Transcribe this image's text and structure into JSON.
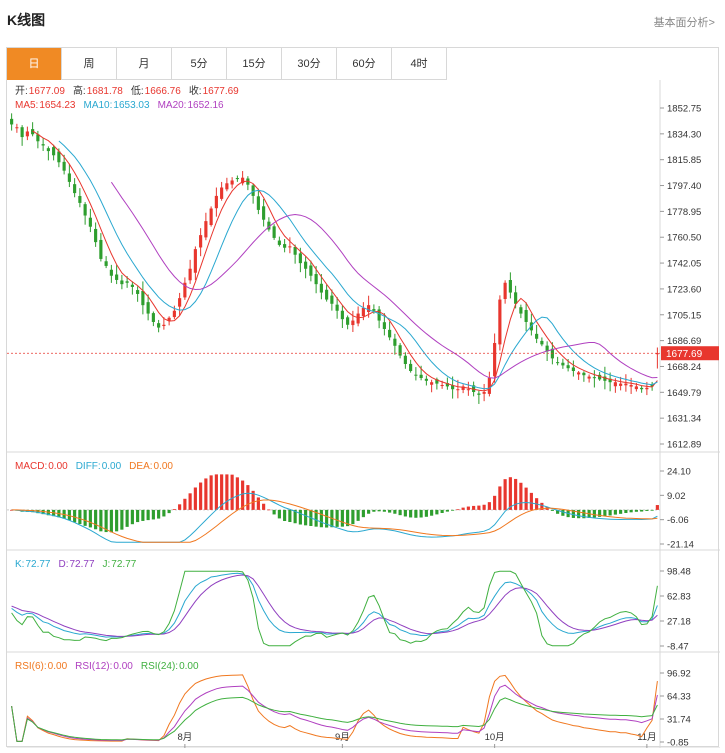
{
  "page": {
    "title": "K线图",
    "link": "基本面分析>"
  },
  "tabs": [
    {
      "label": "日",
      "active": true
    },
    {
      "label": "周",
      "active": false
    },
    {
      "label": "月",
      "active": false
    },
    {
      "label": "5分",
      "active": false
    },
    {
      "label": "15分",
      "active": false
    },
    {
      "label": "30分",
      "active": false
    },
    {
      "label": "60分",
      "active": false
    },
    {
      "label": "4时",
      "active": false
    }
  ],
  "colors": {
    "up": "#e8362e",
    "down": "#2e9e2e",
    "ma5": "#e8362e",
    "ma10": "#2aa8d0",
    "ma20": "#b040c0",
    "macd": "#e8362e",
    "diff": "#2aa8d0",
    "dea": "#f07820",
    "kdj_k": "#2aa8d0",
    "kdj_d": "#9040c0",
    "kdj_j": "#40b040",
    "rsi6": "#f07820",
    "rsi12": "#b040c0",
    "rsi24": "#40b040",
    "price_tag": "#e8362e"
  },
  "legend": {
    "ohlc": [
      {
        "label": "开:",
        "value": "1677.09"
      },
      {
        "label": "高:",
        "value": "1681.78"
      },
      {
        "label": "低:",
        "value": "1666.76"
      },
      {
        "label": "收:",
        "value": "1677.69"
      }
    ],
    "ma": [
      {
        "label": "MA5: ",
        "value": "1654.23"
      },
      {
        "label": "MA10: ",
        "value": "1653.03"
      },
      {
        "label": "MA20: ",
        "value": "1652.16"
      }
    ],
    "macd": [
      {
        "label": "MACD: ",
        "value": "0.00"
      },
      {
        "label": "DIFF: ",
        "value": "0.00"
      },
      {
        "label": "DEA: ",
        "value": "0.00"
      }
    ],
    "kdj": [
      {
        "label": "K: ",
        "value": "72.77"
      },
      {
        "label": "D: ",
        "value": "72.77"
      },
      {
        "label": "J: ",
        "value": "72.77"
      }
    ],
    "rsi": [
      {
        "label": "RSI(6): ",
        "value": "0.00"
      },
      {
        "label": "RSI(12): ",
        "value": "0.00"
      },
      {
        "label": "RSI(24): ",
        "value": "0.00"
      }
    ]
  },
  "chart_data": [
    {
      "type": "candlestick",
      "id": "price",
      "y_ticks": [
        "1852.75",
        "1834.30",
        "1815.85",
        "1797.40",
        "1778.95",
        "1760.50",
        "1742.05",
        "1723.60",
        "1705.15",
        "1686.69",
        "1668.24",
        "1649.79",
        "1631.34",
        "1612.89"
      ],
      "ylim": [
        1612.89,
        1852.75
      ],
      "last_price": "1677.69",
      "x_labels": [
        "8月",
        "9月",
        "10月",
        "11月"
      ],
      "x_label_index": [
        33,
        63,
        92,
        121
      ],
      "closes": [
        1841,
        1839,
        1832,
        1836,
        1834,
        1829,
        1826,
        1822,
        1819,
        1814,
        1808,
        1800,
        1792,
        1785,
        1776,
        1768,
        1757,
        1745,
        1740,
        1733,
        1730,
        1727,
        1728,
        1725,
        1720,
        1712,
        1706,
        1700,
        1696,
        1698,
        1703,
        1708,
        1717,
        1728,
        1738,
        1752,
        1762,
        1772,
        1781,
        1790,
        1796,
        1799,
        1801,
        1802,
        1803,
        1798,
        1790,
        1780,
        1773,
        1766,
        1760,
        1755,
        1753,
        1754,
        1748,
        1742,
        1738,
        1733,
        1727,
        1721,
        1716,
        1713,
        1708,
        1702,
        1698,
        1701,
        1706,
        1710,
        1712,
        1708,
        1701,
        1695,
        1689,
        1683,
        1676,
        1670,
        1665,
        1662,
        1660,
        1658,
        1657,
        1656,
        1655,
        1654,
        1652,
        1652,
        1654,
        1652,
        1650,
        1648,
        1650,
        1660,
        1685,
        1716,
        1728,
        1721,
        1713,
        1706,
        1700,
        1694,
        1688,
        1684,
        1679,
        1674,
        1671,
        1669,
        1667,
        1665,
        1664,
        1662,
        1661,
        1660,
        1659,
        1658,
        1657,
        1657,
        1656,
        1656,
        1655,
        1654,
        1652,
        1653,
        1654,
        1677.69
      ]
    },
    {
      "type": "macd",
      "id": "macd",
      "y_ticks": [
        "24.10",
        "9.02",
        "-6.06",
        "-21.14"
      ],
      "ylim": [
        -21.14,
        24.1
      ]
    },
    {
      "type": "kdj",
      "id": "kdj",
      "y_ticks": [
        "98.48",
        "62.83",
        "27.18",
        "-8.47"
      ],
      "ylim": [
        -8.47,
        98.48
      ]
    },
    {
      "type": "rsi",
      "id": "rsi",
      "y_ticks": [
        "96.92",
        "64.33",
        "31.74",
        "-0.85"
      ],
      "ylim": [
        -0.85,
        96.92
      ]
    }
  ]
}
